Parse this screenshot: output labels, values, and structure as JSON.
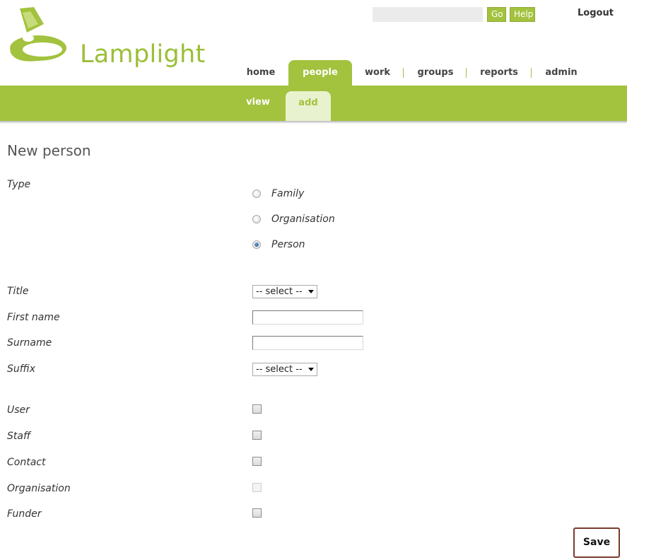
{
  "header": {
    "brand": "Lamplight",
    "search": {
      "value": "",
      "placeholder": ""
    },
    "go_label": "Go",
    "help_label": "Help",
    "logout_label": "Logout"
  },
  "nav": {
    "items": [
      {
        "label": "home",
        "active": false
      },
      {
        "label": "people",
        "active": true
      },
      {
        "label": "work",
        "active": false
      },
      {
        "label": "groups",
        "active": false
      },
      {
        "label": "reports",
        "active": false
      },
      {
        "label": "admin",
        "active": false
      }
    ]
  },
  "subnav": {
    "items": [
      {
        "label": "view",
        "active": false
      },
      {
        "label": "add",
        "active": true
      }
    ]
  },
  "page": {
    "title": "New person"
  },
  "form": {
    "type_label": "Type",
    "type_options": [
      {
        "label": "Family",
        "checked": false
      },
      {
        "label": "Organisation",
        "checked": false
      },
      {
        "label": "Person",
        "checked": true
      }
    ],
    "title_label": "Title",
    "title_select": "-- select --",
    "first_name_label": "First name",
    "first_name_value": "",
    "surname_label": "Surname",
    "surname_value": "",
    "suffix_label": "Suffix",
    "suffix_select": "-- select --",
    "roles": [
      {
        "label": "User",
        "checked": false,
        "disabled": false
      },
      {
        "label": "Staff",
        "checked": false,
        "disabled": false
      },
      {
        "label": "Contact",
        "checked": false,
        "disabled": false
      },
      {
        "label": "Organisation",
        "checked": false,
        "disabled": true
      },
      {
        "label": "Funder",
        "checked": false,
        "disabled": false
      }
    ],
    "save_label": "Save"
  },
  "colors": {
    "brand_green": "#a3c23e",
    "subnav_active_bg": "#e9f2ce",
    "save_border": "#7a3b2e"
  },
  "icons": [
    "lamp-logo-icon",
    "chevron-down-icon"
  ]
}
